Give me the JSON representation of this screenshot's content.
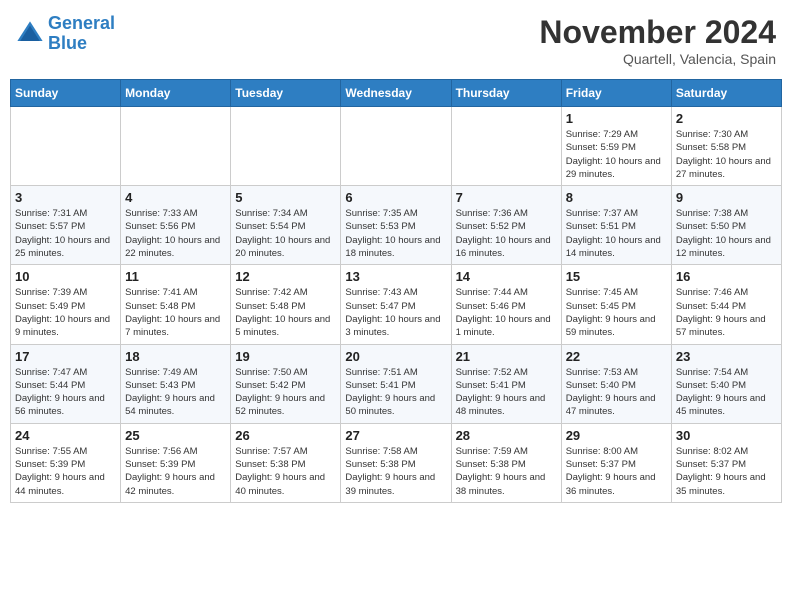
{
  "header": {
    "logo_line1": "General",
    "logo_line2": "Blue",
    "month": "November 2024",
    "location": "Quartell, Valencia, Spain"
  },
  "weekdays": [
    "Sunday",
    "Monday",
    "Tuesday",
    "Wednesday",
    "Thursday",
    "Friday",
    "Saturday"
  ],
  "weeks": [
    [
      {
        "day": "",
        "info": ""
      },
      {
        "day": "",
        "info": ""
      },
      {
        "day": "",
        "info": ""
      },
      {
        "day": "",
        "info": ""
      },
      {
        "day": "",
        "info": ""
      },
      {
        "day": "1",
        "info": "Sunrise: 7:29 AM\nSunset: 5:59 PM\nDaylight: 10 hours and 29 minutes."
      },
      {
        "day": "2",
        "info": "Sunrise: 7:30 AM\nSunset: 5:58 PM\nDaylight: 10 hours and 27 minutes."
      }
    ],
    [
      {
        "day": "3",
        "info": "Sunrise: 7:31 AM\nSunset: 5:57 PM\nDaylight: 10 hours and 25 minutes."
      },
      {
        "day": "4",
        "info": "Sunrise: 7:33 AM\nSunset: 5:56 PM\nDaylight: 10 hours and 22 minutes."
      },
      {
        "day": "5",
        "info": "Sunrise: 7:34 AM\nSunset: 5:54 PM\nDaylight: 10 hours and 20 minutes."
      },
      {
        "day": "6",
        "info": "Sunrise: 7:35 AM\nSunset: 5:53 PM\nDaylight: 10 hours and 18 minutes."
      },
      {
        "day": "7",
        "info": "Sunrise: 7:36 AM\nSunset: 5:52 PM\nDaylight: 10 hours and 16 minutes."
      },
      {
        "day": "8",
        "info": "Sunrise: 7:37 AM\nSunset: 5:51 PM\nDaylight: 10 hours and 14 minutes."
      },
      {
        "day": "9",
        "info": "Sunrise: 7:38 AM\nSunset: 5:50 PM\nDaylight: 10 hours and 12 minutes."
      }
    ],
    [
      {
        "day": "10",
        "info": "Sunrise: 7:39 AM\nSunset: 5:49 PM\nDaylight: 10 hours and 9 minutes."
      },
      {
        "day": "11",
        "info": "Sunrise: 7:41 AM\nSunset: 5:48 PM\nDaylight: 10 hours and 7 minutes."
      },
      {
        "day": "12",
        "info": "Sunrise: 7:42 AM\nSunset: 5:48 PM\nDaylight: 10 hours and 5 minutes."
      },
      {
        "day": "13",
        "info": "Sunrise: 7:43 AM\nSunset: 5:47 PM\nDaylight: 10 hours and 3 minutes."
      },
      {
        "day": "14",
        "info": "Sunrise: 7:44 AM\nSunset: 5:46 PM\nDaylight: 10 hours and 1 minute."
      },
      {
        "day": "15",
        "info": "Sunrise: 7:45 AM\nSunset: 5:45 PM\nDaylight: 9 hours and 59 minutes."
      },
      {
        "day": "16",
        "info": "Sunrise: 7:46 AM\nSunset: 5:44 PM\nDaylight: 9 hours and 57 minutes."
      }
    ],
    [
      {
        "day": "17",
        "info": "Sunrise: 7:47 AM\nSunset: 5:44 PM\nDaylight: 9 hours and 56 minutes."
      },
      {
        "day": "18",
        "info": "Sunrise: 7:49 AM\nSunset: 5:43 PM\nDaylight: 9 hours and 54 minutes."
      },
      {
        "day": "19",
        "info": "Sunrise: 7:50 AM\nSunset: 5:42 PM\nDaylight: 9 hours and 52 minutes."
      },
      {
        "day": "20",
        "info": "Sunrise: 7:51 AM\nSunset: 5:41 PM\nDaylight: 9 hours and 50 minutes."
      },
      {
        "day": "21",
        "info": "Sunrise: 7:52 AM\nSunset: 5:41 PM\nDaylight: 9 hours and 48 minutes."
      },
      {
        "day": "22",
        "info": "Sunrise: 7:53 AM\nSunset: 5:40 PM\nDaylight: 9 hours and 47 minutes."
      },
      {
        "day": "23",
        "info": "Sunrise: 7:54 AM\nSunset: 5:40 PM\nDaylight: 9 hours and 45 minutes."
      }
    ],
    [
      {
        "day": "24",
        "info": "Sunrise: 7:55 AM\nSunset: 5:39 PM\nDaylight: 9 hours and 44 minutes."
      },
      {
        "day": "25",
        "info": "Sunrise: 7:56 AM\nSunset: 5:39 PM\nDaylight: 9 hours and 42 minutes."
      },
      {
        "day": "26",
        "info": "Sunrise: 7:57 AM\nSunset: 5:38 PM\nDaylight: 9 hours and 40 minutes."
      },
      {
        "day": "27",
        "info": "Sunrise: 7:58 AM\nSunset: 5:38 PM\nDaylight: 9 hours and 39 minutes."
      },
      {
        "day": "28",
        "info": "Sunrise: 7:59 AM\nSunset: 5:38 PM\nDaylight: 9 hours and 38 minutes."
      },
      {
        "day": "29",
        "info": "Sunrise: 8:00 AM\nSunset: 5:37 PM\nDaylight: 9 hours and 36 minutes."
      },
      {
        "day": "30",
        "info": "Sunrise: 8:02 AM\nSunset: 5:37 PM\nDaylight: 9 hours and 35 minutes."
      }
    ]
  ]
}
